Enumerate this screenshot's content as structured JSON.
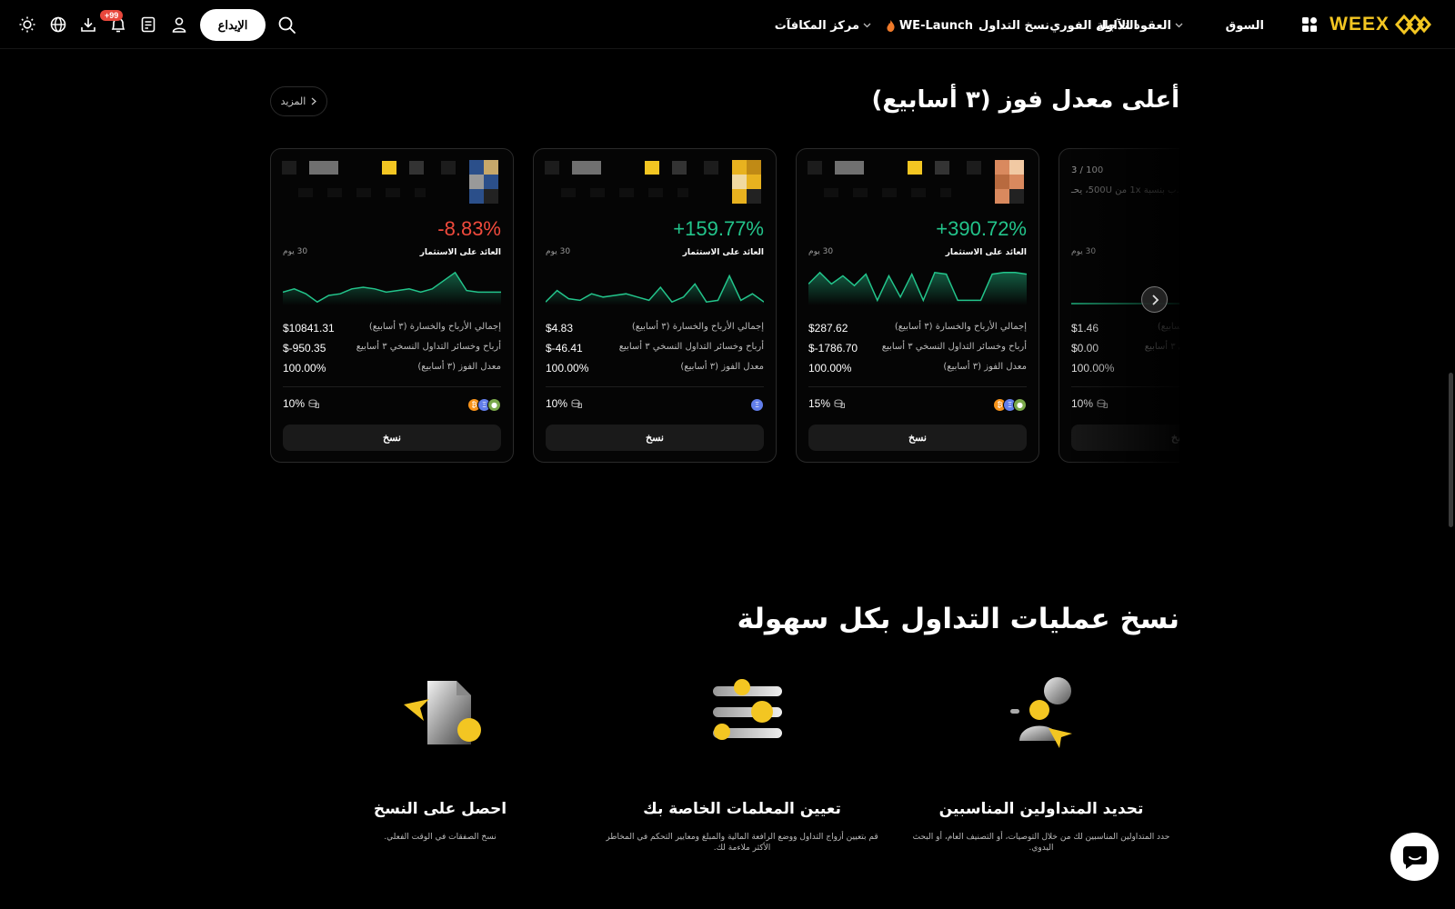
{
  "brand": {
    "name": "WEEX",
    "color": "#f3c622"
  },
  "nav": {
    "market": "السوق",
    "futures": "العقود الآجلة",
    "spot": "التداول الفوري",
    "copy": "نسخ التداول",
    "welaunch": "WE-Launch",
    "rewards": "مركز المكافآت"
  },
  "toolbar": {
    "deposit": "الإيداع",
    "notifications_badge": "+99",
    "icons": [
      "search-icon",
      "user-icon",
      "orders-icon",
      "bell-icon",
      "download-icon",
      "globe-icon",
      "sun-icon"
    ]
  },
  "colors": {
    "positive": "#23c48b",
    "negative": "#f04a3c",
    "accent": "#f3c622"
  },
  "section1": {
    "title": "أعلى معدل فوز (٣ أسابيع)",
    "more": "المزيد",
    "labels": {
      "roi": "العائد على الاستثمار",
      "days": "30 يوم",
      "pnl": "إجمالي الأرباح والخسارة (٣ أسابيع)",
      "copy_pnl": "أرباح وخسائر التداول النسخي ٣ أسابيع",
      "win_rate": "معدل الفوز (٣ أسابيع)",
      "copy": "نسخ"
    },
    "cards": [
      {
        "roi": "+390.72%",
        "roi_trend": "positive",
        "pnl": "$287.62",
        "copy_pnl": "$-1786.70",
        "win_rate": "100.00%",
        "share": "15%",
        "coins": [
          "btc",
          "eth",
          "other"
        ],
        "spark": [
          0.6,
          0.95,
          0.6,
          0.85,
          0.55,
          0.9,
          0.1,
          0.85,
          0.2,
          0.9,
          0.1,
          0.95,
          0.9,
          0.1,
          0.1,
          0.1,
          0.9,
          0.95,
          0.95,
          0.9
        ]
      },
      {
        "roi": "+159.77%",
        "roi_trend": "positive",
        "pnl": "$4.83",
        "copy_pnl": "$-46.41",
        "win_rate": "100.00%",
        "share": "10%",
        "coins": [
          "eth"
        ],
        "spark": [
          0.05,
          0.4,
          0.15,
          0.1,
          0.3,
          0.2,
          0.25,
          0.3,
          0.2,
          0.1,
          0.5,
          0.05,
          0.2,
          0.6,
          0.05,
          0.1,
          0.85,
          0.1,
          0.3,
          0.05
        ]
      },
      {
        "roi": "-8.83%",
        "roi_trend": "negative",
        "pnl": "$10841.31",
        "copy_pnl": "$-950.35",
        "win_rate": "100.00%",
        "share": "10%",
        "coins": [
          "btc",
          "eth",
          "other"
        ],
        "spark": [
          0.35,
          0.45,
          0.3,
          0.05,
          0.25,
          0.3,
          0.45,
          0.5,
          0.45,
          0.35,
          0.4,
          0.45,
          0.35,
          0.45,
          0.7,
          0.95,
          0.4,
          0.35,
          0.35,
          0.35
        ]
      },
      {
        "members": "3 / 100",
        "desc": "...ب بنسبة 1x من 500U، يحـ",
        "pnl": "$1.46",
        "copy_pnl": "$0.00",
        "win_rate": "100.00%",
        "share": "10%",
        "spark": [
          0.0,
          0.0,
          0.0,
          0.0,
          0.0,
          0.0,
          0.0,
          0.0,
          0.0,
          0.0,
          0.0,
          0.0,
          0.0,
          0.0,
          0.0,
          0.0,
          0.0,
          0.9,
          0.0,
          0.0
        ]
      }
    ]
  },
  "section2": {
    "title": "نسخ عمليات التداول بكل سهولة",
    "features": [
      {
        "title": "تحديد المتداولين المناسبين",
        "desc": "حدد المتداولين المناسبين لك من خلال التوصيات، أو التصنيف العام، أو البحث اليدوي."
      },
      {
        "title": "تعيين المعلمات الخاصة بك",
        "desc": "قم بتعيين أزواج التداول ووضع الرافعة المالية والمبلغ ومعايير التحكم في المخاطر الأكثر ملاءمة لك."
      },
      {
        "title": "احصل على النسخ",
        "desc": "نسخ الصفقات في الوقت الفعلي."
      }
    ]
  }
}
